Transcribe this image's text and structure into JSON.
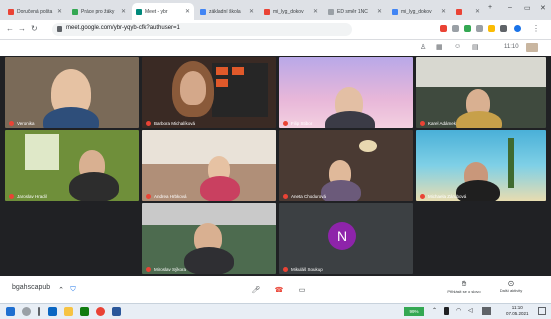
{
  "browser": {
    "tabs": [
      {
        "label": "Doručená pošta",
        "color": "#ea4335"
      },
      {
        "label": "Práce pro žáky",
        "color": "#34a853"
      },
      {
        "label": "Meet - ybr",
        "color": "#00897b"
      },
      {
        "label": "základní škola",
        "color": "#4285f4"
      },
      {
        "label": "mi_lyg_dokov",
        "color": "#ea4335"
      },
      {
        "label": "ED směr 1NC",
        "color": "#9aa0a6"
      },
      {
        "label": "mi_lyg_dokov",
        "color": "#4285f4"
      },
      {
        "label": "mi_lyg_dokov",
        "color": "#ea4335"
      }
    ],
    "new_tab": "+",
    "url": "meet.google.com/ybr-yqyb-cfk?authuser=1",
    "clock": "11:10"
  },
  "participants": [
    {
      "name": "Veronika",
      "bg": "#7a6a58",
      "skin": "#e6c2a3"
    },
    {
      "name": "Barbora Michalíková",
      "bg": "#3a2a24",
      "skin": "#d4a88a"
    },
    {
      "name": "Filip Stibor",
      "bg": "#c9b6e6",
      "skin": "#e3bfa4"
    },
    {
      "name": "Karel Adámek",
      "bg": "#3f4a3e",
      "skin": "#d9b091"
    },
    {
      "name": "Jaroslav Hradil",
      "bg": "#6f8f3a",
      "skin": "#d9b091"
    },
    {
      "name": "Andrea Hrbková",
      "bg": "#b08f78",
      "skin": "#e6c2a3"
    },
    {
      "name": "Aneta Chodurová",
      "bg": "#4a3a33",
      "skin": "#e0b99a"
    },
    {
      "name": "Michaela Zárubová",
      "bg": "#5fa8b8",
      "skin": "#c9977a"
    },
    {
      "name": "Miroslav Sýkora",
      "bg": "#4d6b4f",
      "skin": "#d9b091"
    },
    {
      "name": "Mikuláš Soukup",
      "avatar_letter": "N",
      "avatar_color": "#8e24aa"
    }
  ],
  "meeting": {
    "code": "bgahscapub",
    "raise_hand": "Přihlásit se o slovo",
    "activities": "Další aktivity"
  },
  "taskbar": {
    "time": "11:10",
    "date": "07.05.2021",
    "battery": "99%"
  }
}
